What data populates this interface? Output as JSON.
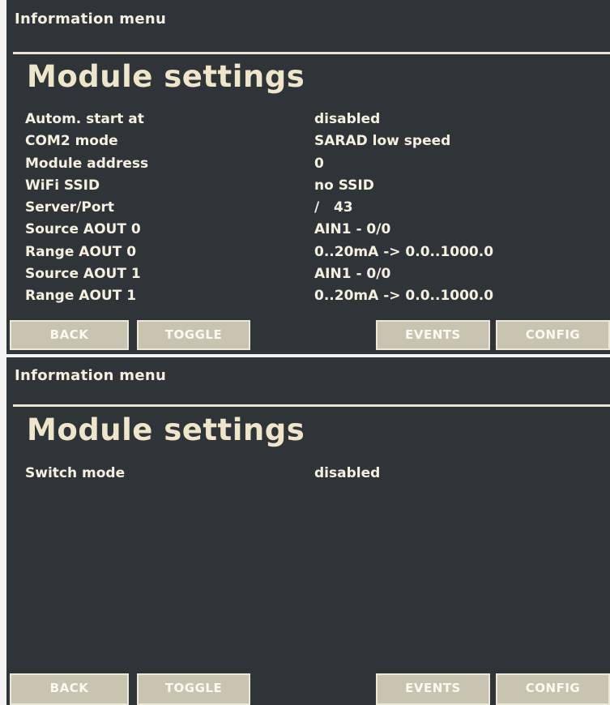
{
  "screen_top": {
    "header": "Information menu",
    "title": "Module settings",
    "rows": [
      {
        "label": "Autom. start at",
        "value": "disabled"
      },
      {
        "label": "COM2 mode",
        "value": "SARAD low speed"
      },
      {
        "label": "Module address",
        "value": "0"
      },
      {
        "label": "WiFi SSID",
        "value": "no SSID"
      },
      {
        "label": "Server/Port",
        "value": "/   43"
      },
      {
        "label": "Source AOUT 0",
        "value": "AIN1 - 0/0"
      },
      {
        "label": "Range AOUT 0",
        "value": "0..20mA -> 0.0..1000.0"
      },
      {
        "label": "Source AOUT 1",
        "value": "AIN1 - 0/0"
      },
      {
        "label": "Range AOUT 1",
        "value": "0..20mA -> 0.0..1000.0"
      }
    ],
    "buttons": {
      "back": "BACK",
      "toggle": "TOGGLE",
      "events": "EVENTS",
      "config": "CONFIG"
    }
  },
  "screen_bottom": {
    "header": "Information menu",
    "title": "Module settings",
    "rows": [
      {
        "label": "Switch mode",
        "value": "disabled"
      }
    ],
    "buttons": {
      "back": "BACK",
      "toggle": "TOGGLE",
      "events": "EVENTS",
      "config": "CONFIG"
    }
  }
}
